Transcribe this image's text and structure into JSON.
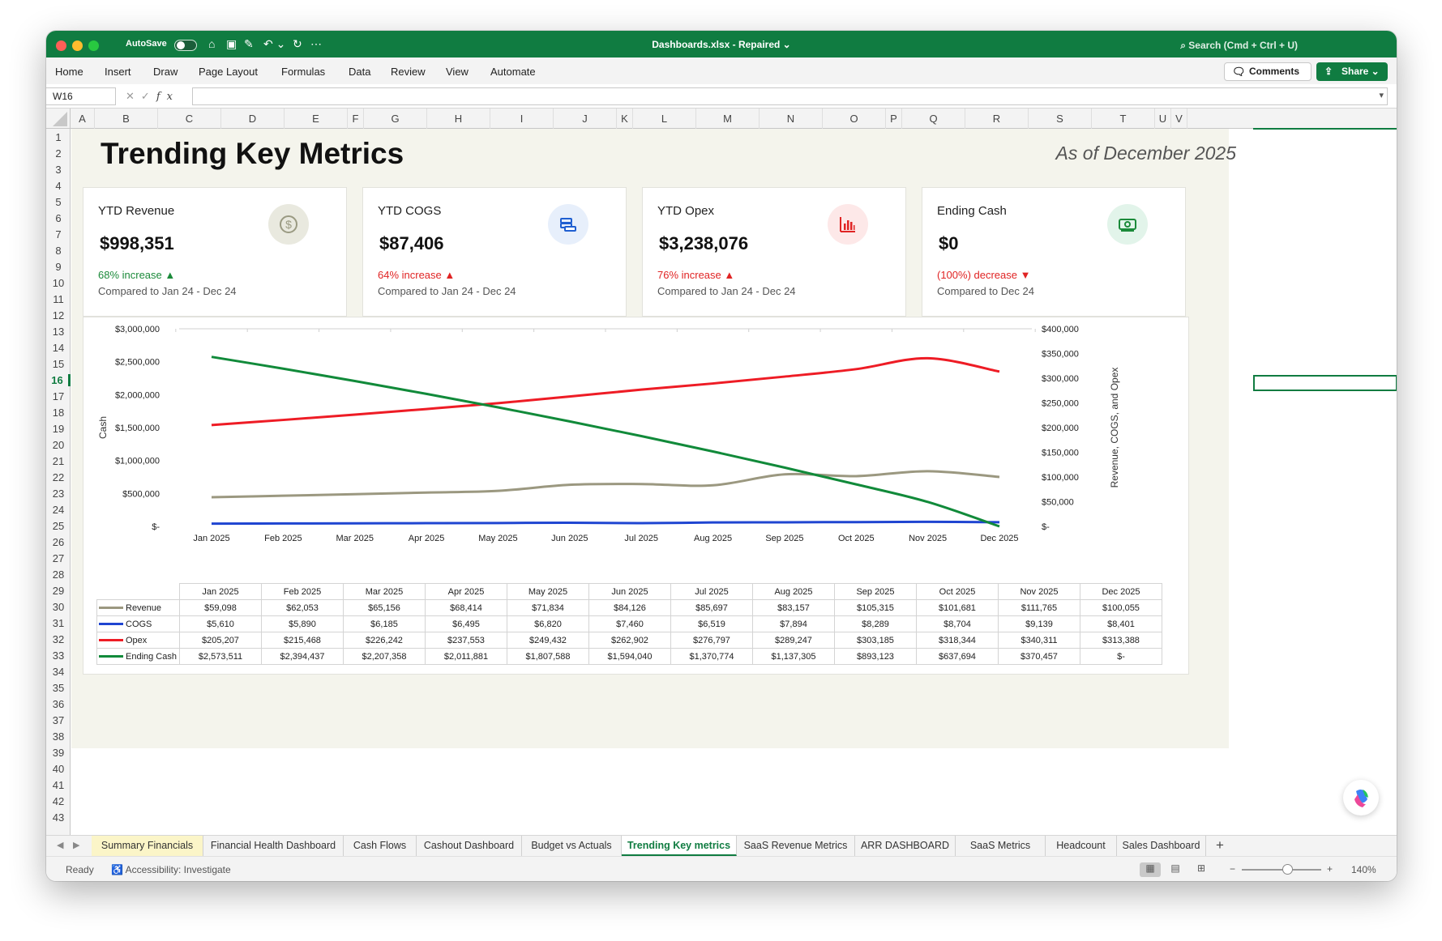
{
  "titlebar": {
    "autosave_label": "AutoSave",
    "doc_title": "Dashboards.xlsx  -  Repaired ⌄",
    "search_placeholder": "Search (Cmd + Ctrl + U)"
  },
  "ribbon": {
    "menu": [
      "Home",
      "Insert",
      "Draw",
      "Page Layout",
      "Formulas",
      "Data",
      "Review",
      "View",
      "Automate"
    ],
    "comments_label": "Comments",
    "share_label": "Share ⌄"
  },
  "formula_bar": {
    "name_box": "W16",
    "fx": "fx",
    "value": ""
  },
  "columns": [
    "A",
    "B",
    "C",
    "D",
    "E",
    "F",
    "G",
    "H",
    "I",
    "J",
    "K",
    "L",
    "M",
    "N",
    "O",
    "P",
    "Q",
    "R",
    "S",
    "T",
    "U",
    "V"
  ],
  "rows": [
    "1",
    "2",
    "3",
    "4",
    "5",
    "6",
    "7",
    "8",
    "9",
    "10",
    "11",
    "12",
    "13",
    "14",
    "15",
    "16",
    "17",
    "18",
    "19",
    "20",
    "21",
    "22",
    "23",
    "24",
    "25",
    "26",
    "27",
    "28",
    "29",
    "30",
    "31",
    "32",
    "33",
    "34",
    "35",
    "36",
    "37",
    "38",
    "39",
    "40",
    "41",
    "42",
    "43"
  ],
  "active_row": "16",
  "dashboard": {
    "title": "Trending Key Metrics",
    "as_of": "As of December 2025",
    "cards": [
      {
        "label": "YTD Revenue",
        "value": "$998,351",
        "delta": "68% increase ▲",
        "compare": "Compared to Jan 24 - Dec 24",
        "icon": "dollar-coin-icon",
        "icon_bg": "#e9e9df",
        "icon_color": "#9a9a82"
      },
      {
        "label": "YTD COGS",
        "value": "$87,406",
        "delta": "64% increase ▲",
        "compare": "Compared to Jan 24 - Dec 24",
        "icon": "coins-stack-icon",
        "icon_bg": "#e7effb",
        "icon_color": "#1f5fd1"
      },
      {
        "label": "YTD Opex",
        "value": "$3,238,076",
        "delta": "76% increase ▲",
        "compare": "Compared to Jan 24 - Dec 24",
        "icon": "bar-chart-icon",
        "icon_bg": "#fde8e8",
        "icon_color": "#e02424"
      },
      {
        "label": "Ending Cash",
        "value": "$0",
        "delta": "(100%) decrease ▼",
        "compare": "Compared to Dec 24",
        "icon": "cash-note-icon",
        "icon_bg": "#e2f4ea",
        "icon_color": "#1b8a3a"
      }
    ]
  },
  "chart_data": {
    "type": "line",
    "x": [
      "Jan 2025",
      "Feb 2025",
      "Mar 2025",
      "Apr 2025",
      "May 2025",
      "Jun 2025",
      "Jul 2025",
      "Aug 2025",
      "Sep 2025",
      "Oct 2025",
      "Nov 2025",
      "Dec 2025"
    ],
    "ylabel_left": "Cash",
    "ylabel_right": "Revenue, COGS, and Opex",
    "y_left_ticks": [
      "$3,000,000",
      "$2,500,000",
      "$2,000,000",
      "$1,500,000",
      "$1,000,000",
      "$500,000",
      "$-"
    ],
    "y_right_ticks": [
      "$400,000",
      "$350,000",
      "$300,000",
      "$250,000",
      "$200,000",
      "$150,000",
      "$100,000",
      "$50,000",
      "$-"
    ],
    "ylim_left": [
      0,
      3000000
    ],
    "ylim_right": [
      0,
      400000
    ],
    "grid": false,
    "series": [
      {
        "name": "Revenue",
        "axis": "right",
        "color": "#9b9880",
        "values": [
          59098,
          62053,
          65156,
          68414,
          71834,
          84126,
          85697,
          83157,
          105315,
          101681,
          111765,
          100055
        ],
        "labels": [
          "$59,098",
          "$62,053",
          "$65,156",
          "$68,414",
          "$71,834",
          "$84,126",
          "$85,697",
          "$83,157",
          "$105,315",
          "$101,681",
          "$111,765",
          "$100,055"
        ]
      },
      {
        "name": "COGS",
        "axis": "right",
        "color": "#1f45d1",
        "values": [
          5610,
          5890,
          6185,
          6495,
          6820,
          7460,
          6519,
          7894,
          8289,
          8704,
          9139,
          8401
        ],
        "labels": [
          "$5,610",
          "$5,890",
          "$6,185",
          "$6,495",
          "$6,820",
          "$7,460",
          "$6,519",
          "$7,894",
          "$8,289",
          "$8,704",
          "$9,139",
          "$8,401"
        ]
      },
      {
        "name": "Opex",
        "axis": "right",
        "color": "#ee1c25",
        "values": [
          205207,
          215468,
          226242,
          237553,
          249432,
          262902,
          276797,
          289247,
          303185,
          318344,
          340311,
          313388
        ],
        "labels": [
          "$205,207",
          "$215,468",
          "$226,242",
          "$237,553",
          "$249,432",
          "$262,902",
          "$276,797",
          "$289,247",
          "$303,185",
          "$318,344",
          "$340,311",
          "$313,388"
        ]
      },
      {
        "name": "Ending Cash",
        "axis": "left",
        "color": "#118a3a",
        "values": [
          2573511,
          2394437,
          2207358,
          2011881,
          1807588,
          1594040,
          1370774,
          1137305,
          893123,
          637694,
          370457,
          0
        ],
        "labels": [
          "$2,573,511",
          "$2,394,437",
          "$2,207,358",
          "$2,011,881",
          "$1,807,588",
          "$1,594,040",
          "$1,370,774",
          "$1,137,305",
          "$893,123",
          "$637,694",
          "$370,457",
          "$-"
        ]
      }
    ]
  },
  "sheet_tabs": [
    "Summary Financials",
    "Financial Health Dashboard",
    "Cash Flows",
    "Cashout Dashboard",
    "Budget vs Actuals",
    "Trending Key metrics",
    "SaaS Revenue Metrics",
    "ARR DASHBOARD",
    "SaaS Metrics",
    "Headcount",
    "Sales Dashboard"
  ],
  "active_tab": "Trending Key metrics",
  "status": {
    "ready": "Ready",
    "accessibility": "Accessibility: Investigate",
    "zoom": "140%",
    "zoom_percent": 140
  }
}
